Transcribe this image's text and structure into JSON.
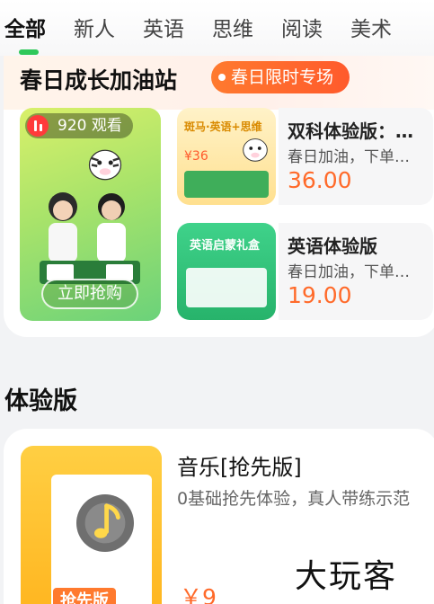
{
  "tabs": [
    "全部",
    "新人",
    "英语",
    "思维",
    "阅读",
    "美术"
  ],
  "promo": {
    "title": "春日成长加油站",
    "badge": "春日限时专场",
    "live": {
      "viewers": "920 观看",
      "cta": "立即抢购",
      "banner_text": "春日成长加油站"
    },
    "products": [
      {
        "name": "双科体验版：斑马·英语+思维",
        "subtitle": "春日加油，下单有礼",
        "price": "36.00",
        "image_title": "斑马·英语+思维",
        "image_price": "¥36"
      },
      {
        "name": "英语体验版",
        "subtitle": "春日加油，下单有礼",
        "price": "19.00",
        "image_title": "英语启蒙礼盒"
      }
    ]
  },
  "section": {
    "title": "体验版"
  },
  "course": {
    "title": "音乐[抢先版]",
    "description": "0基础抢先体验，真人带练示范",
    "price": "￥9",
    "image_label": "抢先版"
  },
  "watermark": "大玩客",
  "colors": {
    "accent_green": "#2fc85a",
    "price_orange": "#ff6a2a",
    "badge_orange": "#ff5a2c"
  },
  "icons": [
    "live-icon",
    "music-note-icon",
    "zebra-mascot-icon"
  ]
}
